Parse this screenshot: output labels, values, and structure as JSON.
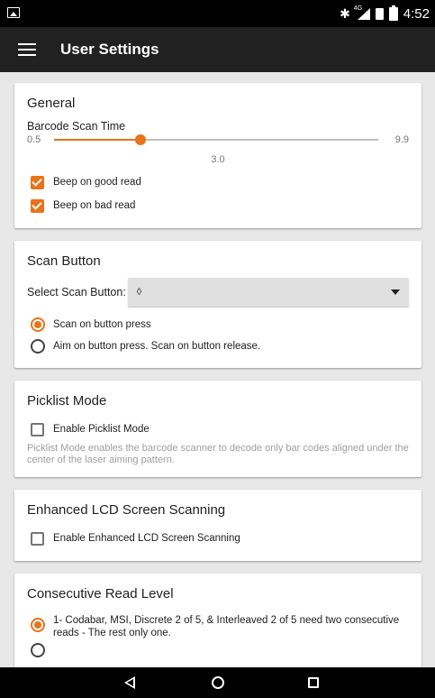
{
  "status_bar": {
    "time": "4:52",
    "network": "4G"
  },
  "app_bar": {
    "title": "User Settings"
  },
  "general": {
    "title": "General",
    "scan_time_label": "Barcode Scan Time",
    "scan_time_min": "0.5",
    "scan_time_max": "9.9",
    "scan_time_value": "3.0",
    "scan_time_fraction": 0.266,
    "beep_good_label": "Beep on good read",
    "beep_bad_label": "Beep on bad read"
  },
  "scan_button": {
    "title": "Scan Button",
    "select_label": "Select Scan Button:",
    "select_value": "◊",
    "option_press": "Scan on button press",
    "option_release": "Aim on button press. Scan on button release."
  },
  "picklist": {
    "title": "Picklist Mode",
    "enable_label": "Enable Picklist Mode",
    "description": "Picklist Mode enables the barcode scanner to decode only bar codes aligned under the center of the laser aiming pattern."
  },
  "lcd": {
    "title": "Enhanced LCD Screen Scanning",
    "enable_label": "Enable Enhanced LCD Screen Scanning"
  },
  "consecutive": {
    "title": "Consecutive Read Level",
    "option_1": "1- Codabar, MSI, Discrete 2 of 5, & Interleaved 2 of 5 need two consecutive reads - The rest only one."
  },
  "colors": {
    "accent": "#e8731a",
    "app_bar": "#212121",
    "background": "#e8e8e8"
  }
}
